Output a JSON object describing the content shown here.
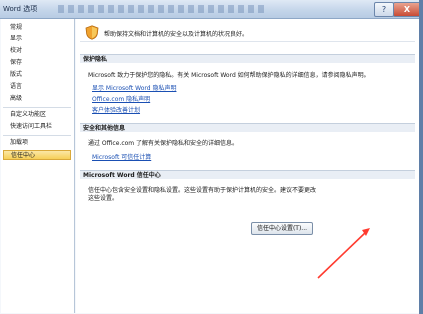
{
  "window": {
    "title": "Word 选项",
    "help_glyph": "?",
    "close_glyph": "X"
  },
  "sidebar": {
    "items": [
      {
        "label": "常规"
      },
      {
        "label": "显示"
      },
      {
        "label": "校对"
      },
      {
        "label": "保存"
      },
      {
        "label": "版式"
      },
      {
        "label": "语言"
      },
      {
        "label": "高级"
      },
      {
        "label": "自定义功能区"
      },
      {
        "label": "快速访问工具栏"
      },
      {
        "label": "加载项"
      },
      {
        "label": "信任中心"
      }
    ],
    "selected": "信任中心"
  },
  "main": {
    "intro_text": "帮助保持文档和计算机的安全以及计算机的状况良好。",
    "privacy": {
      "header": "保护隐私",
      "text": "Microsoft 致力于保护您的隐私。有关 Microsoft Word 如何帮助保护隐私的详细信息，请参阅隐私声明。",
      "links": [
        "显示 Microsoft Word 隐私声明",
        "Office.com 隐私声明",
        "客户体验改善计划"
      ]
    },
    "security": {
      "header": "安全和其他信息",
      "text": "通过 Office.com 了解有关保护隐私和安全的详细信息。",
      "link": "Microsoft 可信任计算"
    },
    "trust": {
      "header": "Microsoft Word 信任中心",
      "text_line1": "信任中心包含安全设置和隐私设置。这些设置有助于保护计算机的安全。建议不要更改",
      "text_line2": "这些设置。",
      "button_label": "信任中心设置(T)..."
    }
  },
  "colors": {
    "accent_selected": "#f6cf58",
    "link": "#1a4fb3",
    "annotation_arrow": "#ff3b2f"
  }
}
